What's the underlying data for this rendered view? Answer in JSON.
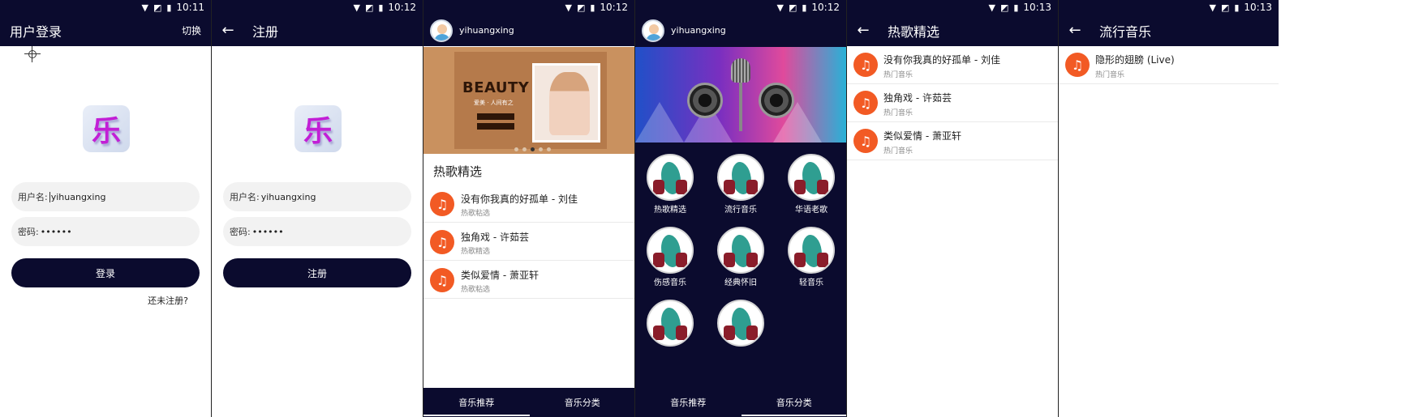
{
  "status_times": [
    "10:11",
    "10:12",
    "10:12",
    "10:12",
    "10:13",
    "10:13"
  ],
  "login": {
    "title": "用户登录",
    "switch_label": "切换",
    "logo_glyph": "乐",
    "username_label": "用户名:",
    "username_value": "yihuangxing",
    "password_label": "密码:",
    "password_value": "••••••",
    "login_button": "登录",
    "register_link": "还未注册?"
  },
  "register": {
    "title": "注册",
    "logo_glyph": "乐",
    "username_label": "用户名:",
    "username_value": "yihuangxing",
    "password_label": "密码:",
    "password_value": "••••••",
    "register_button": "注册"
  },
  "home": {
    "username": "yihuangxing",
    "banner": {
      "heading": "BEAUTY",
      "tagline": "爱美 · 人间有之"
    },
    "section_title": "热歌精选",
    "songs": [
      {
        "name": "没有你我真的好孤单 - 刘佳",
        "category": "热歌粘选"
      },
      {
        "name": "独角戏 - 许茹芸",
        "category": "热歌精选"
      },
      {
        "name": "类似爱情 - 萧亚轩",
        "category": "热歌粘选"
      }
    ],
    "tabs": [
      "音乐推荐",
      "音乐分类"
    ]
  },
  "categories": {
    "username": "yihuangxing",
    "items": [
      "热歌精选",
      "流行音乐",
      "华语老歌",
      "伤感音乐",
      "经典怀旧",
      "轻音乐",
      "",
      ""
    ],
    "tabs": [
      "音乐推荐",
      "音乐分类"
    ]
  },
  "hot_list": {
    "title": "热歌精选",
    "songs": [
      {
        "name": "没有你我真的好孤单 - 刘佳",
        "category": "热门音乐"
      },
      {
        "name": "独角戏 - 许茹芸",
        "category": "热门音乐"
      },
      {
        "name": "类似爱情 - 萧亚轩",
        "category": "热门音乐"
      }
    ]
  },
  "pop_list": {
    "title": "流行音乐",
    "songs": [
      {
        "name": "隐形的翅膀 (Live)",
        "category": "热门音乐"
      }
    ]
  },
  "icons": {
    "back": "←",
    "note": "♫"
  },
  "colors": {
    "navy": "#0b0b2e",
    "note_orange": "#f25a24"
  }
}
